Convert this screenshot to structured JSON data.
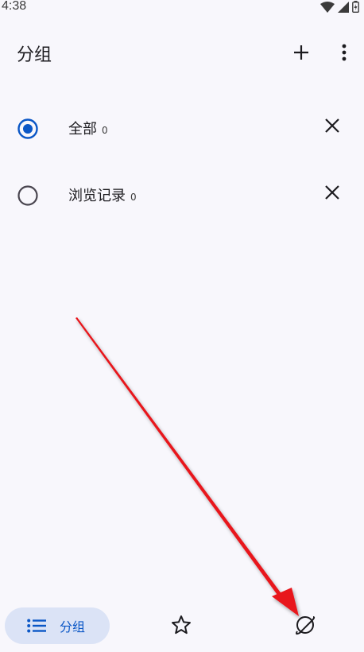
{
  "status_bar": {
    "time": "4:38",
    "icons": [
      "wifi-icon",
      "signal-icon",
      "battery-charging-icon"
    ]
  },
  "header": {
    "title": "分组",
    "icons": [
      "add-icon",
      "more-vert-icon"
    ]
  },
  "groups": [
    {
      "label": "全部",
      "count": "0",
      "selected": true,
      "icon": "close-icon"
    },
    {
      "label": "浏览记录",
      "count": "0",
      "selected": false,
      "icon": "close-icon"
    }
  ],
  "bottom_nav": {
    "groups_label": "分组",
    "groups_icon": "list-icon",
    "favorites_icon": "star-outline-icon",
    "explore_icon": "planet-icon",
    "active": "groups"
  },
  "colors": {
    "background": "#f8f7fc",
    "accent": "#0b57c6",
    "nav_active_bg": "#dbe3f6",
    "annotation_arrow": "#e8141a"
  }
}
